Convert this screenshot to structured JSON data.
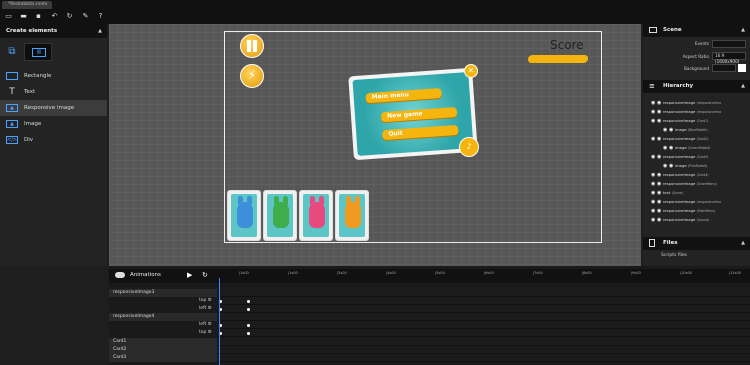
{
  "tab": {
    "title": "*Redrabbits.nnmi"
  },
  "left": {
    "header": "Create elements",
    "items": [
      {
        "label": "Rectangle",
        "icon": "rectangle-icon"
      },
      {
        "label": "Text",
        "icon": "text-icon"
      },
      {
        "label": "Responsive image",
        "icon": "image-icon"
      },
      {
        "label": "Image",
        "icon": "image-icon"
      },
      {
        "label": "Div",
        "icon": "div-icon"
      }
    ]
  },
  "scene": {
    "score": "Score",
    "menu": {
      "items": [
        "Main menu",
        "New game",
        "Quit"
      ]
    }
  },
  "right": {
    "scene_header": "Scene",
    "props": [
      {
        "label": "Events",
        "value": ""
      },
      {
        "label": "Aspect Ratio",
        "value": "16:9 (1600x900)"
      },
      {
        "label": "Background",
        "value": ""
      }
    ],
    "hierarchy_header": "Hierarchy",
    "hierarchy": [
      {
        "name": "responsiveImage",
        "sub": "(responsiveIma"
      },
      {
        "name": "responsiveImage",
        "sub": "(responsiveIma"
      },
      {
        "name": "responsiveImage",
        "sub": "(Card1)"
      },
      {
        "name": "image",
        "sub": "(BlueRabbit)"
      },
      {
        "name": "responsiveImage",
        "sub": "(Card2)"
      },
      {
        "name": "image",
        "sub": "(GreenRabbit)"
      },
      {
        "name": "responsiveImage",
        "sub": "(Card3)"
      },
      {
        "name": "image",
        "sub": "(PinkRabbit)"
      },
      {
        "name": "responsiveImage",
        "sub": "(Card4)"
      },
      {
        "name": "responsiveImage",
        "sub": "(ScoreMenu)"
      },
      {
        "name": "text",
        "sub": "(Score)"
      },
      {
        "name": "responsiveImage",
        "sub": "(responsiveIma"
      },
      {
        "name": "responsiveImage",
        "sub": "(MainMenu)"
      },
      {
        "name": "responsiveImage",
        "sub": "(Sound)"
      }
    ],
    "files_header": "Files",
    "scripts": "Scripts files"
  },
  "animations": {
    "header": "Animations",
    "ticks": [
      "|1s00",
      "|1s00",
      "|3s00",
      "|4s00",
      "|5s00",
      "|6s00",
      "|7s00",
      "|8s00",
      "|9s00",
      "|10s00",
      "|11s00"
    ],
    "rows": [
      {
        "type": "sect",
        "label": "responsiveImage3"
      },
      {
        "type": "sub",
        "label": "top"
      },
      {
        "type": "sub",
        "label": "left"
      },
      {
        "type": "sect",
        "label": "responsiveImage4"
      },
      {
        "type": "sub",
        "label": "left"
      },
      {
        "type": "sub",
        "label": "top"
      },
      {
        "type": "sect",
        "label": "Card1"
      },
      {
        "type": "sect",
        "label": "Card2"
      },
      {
        "type": "sect",
        "label": "Card3"
      }
    ]
  }
}
